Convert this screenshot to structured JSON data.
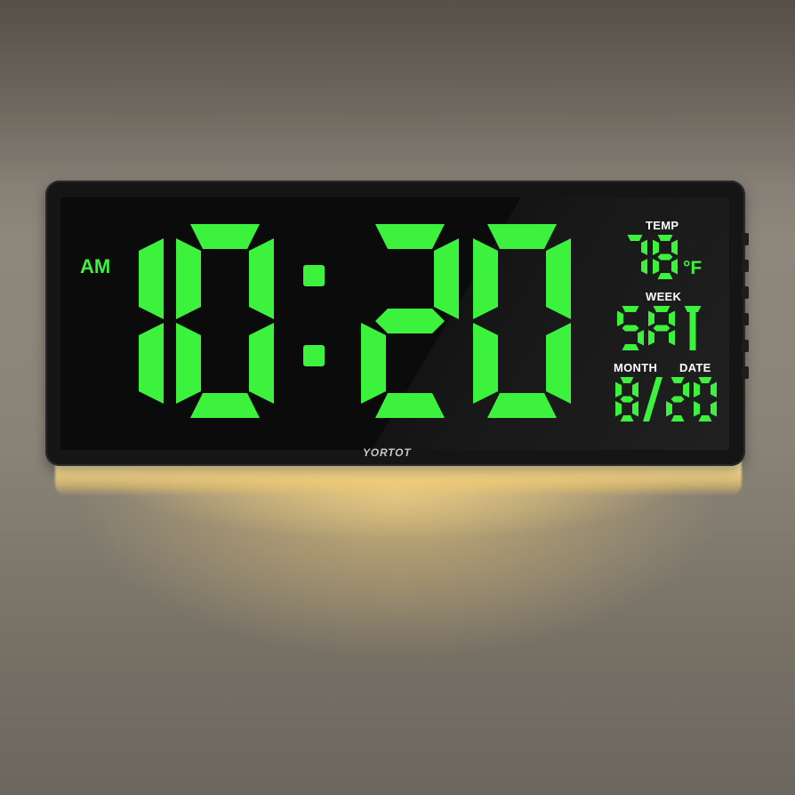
{
  "clock": {
    "brand": "YORTOT",
    "period": "AM",
    "hours": "10",
    "minutes": "20",
    "separator": ":",
    "temp_label": "TEMP",
    "temp_value": "78",
    "temp_unit": "°F",
    "week_label": "WEEK",
    "week_value": "SAT",
    "month_label": "MONTH",
    "date_label": "DATE",
    "date_value": "8/20"
  },
  "colors": {
    "display_green": "#3df23d",
    "label_white": "#ffffff",
    "body_black": "#151515",
    "night_light": "#f6d88a"
  }
}
